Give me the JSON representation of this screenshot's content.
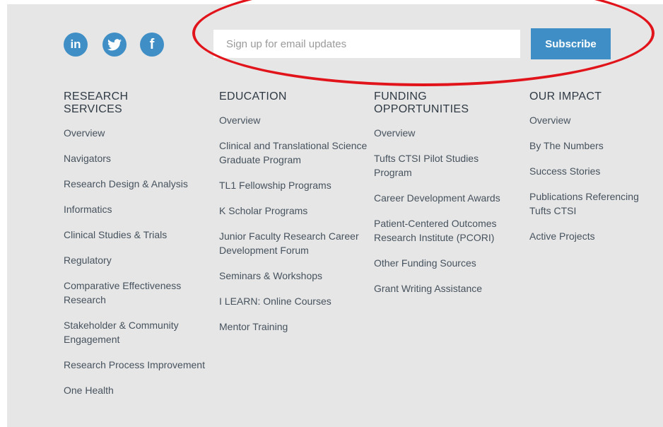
{
  "social": [
    {
      "icon": "linkedin-icon",
      "text": "in"
    },
    {
      "icon": "twitter-icon"
    },
    {
      "icon": "facebook-icon",
      "text": "f"
    }
  ],
  "signup": {
    "placeholder": "Sign up for email updates",
    "button_label": "Subscribe"
  },
  "colors": {
    "accent": "#3f8fc6",
    "panel_bg": "#e6e6e6",
    "highlight": "#e2141b",
    "heading": "#2f3a44",
    "link": "#46525d"
  },
  "columns": [
    {
      "heading": "RESEARCH SERVICES",
      "links": [
        "Overview",
        "Navigators",
        "Research Design & Analysis",
        "Informatics",
        "Clinical Studies & Trials",
        "Regulatory",
        "Comparative Effectiveness Research",
        "Stakeholder & Community Engagement",
        "Research Process Improvement",
        "One Health"
      ]
    },
    {
      "heading": "EDUCATION",
      "links": [
        "Overview",
        "Clinical and Translational Science Graduate Program",
        "TL1 Fellowship Programs",
        "K Scholar Programs",
        "Junior Faculty Research Career Development Forum",
        "Seminars & Workshops",
        "I LEARN: Online Courses",
        "Mentor Training"
      ]
    },
    {
      "heading": "FUNDING OPPORTUNITIES",
      "links": [
        "Overview",
        "Tufts CTSI Pilot Studies Program",
        "Career Development Awards",
        "Patient-Centered Outcomes Research Institute (PCORI)",
        "Other Funding Sources",
        "Grant Writing Assistance"
      ]
    },
    {
      "heading": "OUR IMPACT",
      "links": [
        "Overview",
        "By The Numbers",
        "Success Stories",
        "Publications Referencing Tufts CTSI",
        "Active Projects"
      ]
    }
  ]
}
